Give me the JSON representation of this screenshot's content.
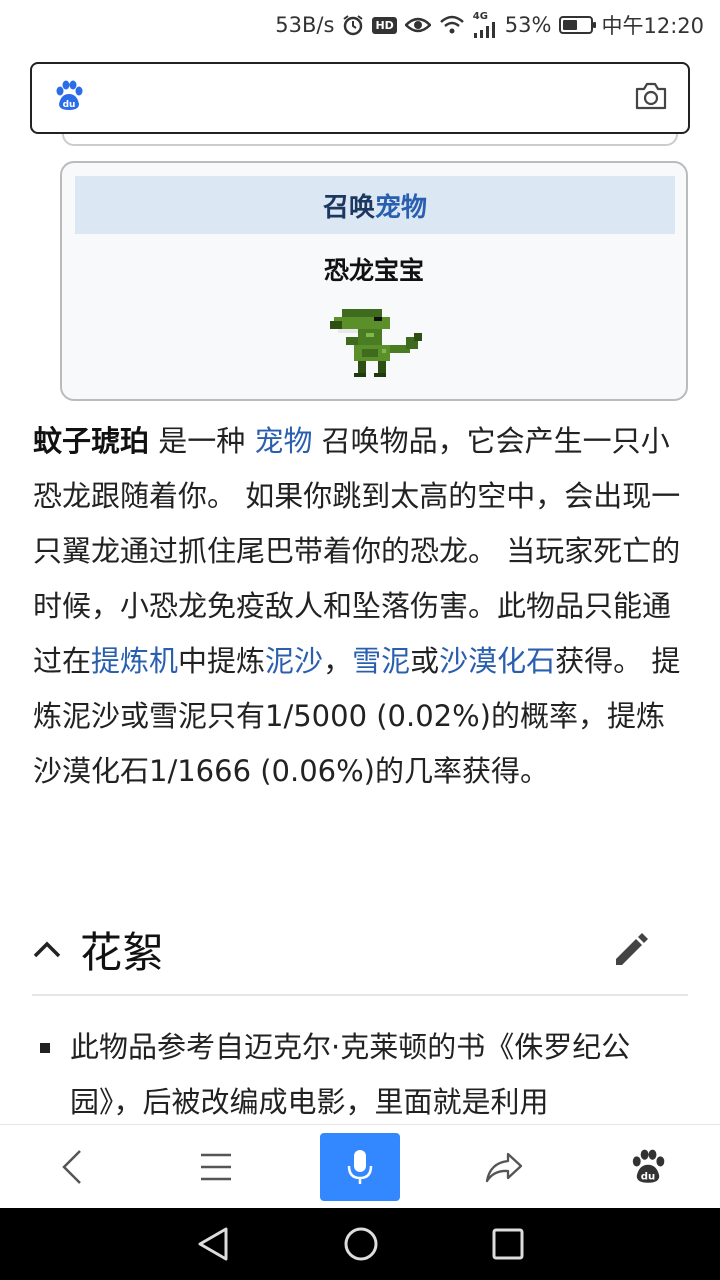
{
  "status_bar": {
    "network_speed": "53B/s",
    "network_type": "4G",
    "battery_percent": "53%",
    "battery_level": 0.53,
    "time": "中午12:20",
    "hd_label": "HD"
  },
  "search": {
    "placeholder": "",
    "logo_icon": "baidu-paw-icon",
    "camera_icon": "camera-icon"
  },
  "infobox": {
    "header_plain": "召唤",
    "header_link": "宠物",
    "pet_name": "恐龙宝宝"
  },
  "article": {
    "term": "蚊子琥珀",
    "t1": " 是一种 ",
    "link_pet": "宠物",
    "t2": " 召唤物品，它会产生一只小恐龙跟随着你。 如果你跳到太高的空中，会出现一只翼龙通过抓住尾巴带着你的恐龙。 当玩家死亡的时候，小恐龙免疫敌人和坠落伤害。此物品只能通过在",
    "link_extractinator": "提炼机",
    "t3": "中提炼",
    "link_silt": "泥沙",
    "t4": "，",
    "link_slush": "雪泥",
    "t5": "或",
    "link_fossil": "沙漠化石",
    "t6": "获得。 提炼泥沙或雪泥只有1/5000 (0.02%)的概率，提炼沙漠化石1/1666 (0.06%)的几率获得。"
  },
  "section": {
    "title": "花絮"
  },
  "trivia": [
    "此物品参考自迈克尔·克莱顿的书《侏罗纪公园》，后被改编成电影，里面就是利用"
  ],
  "colors": {
    "link": "#2a5fb0",
    "voice_button": "#3388ff",
    "infobox_header_bg": "#dbe8f4"
  }
}
